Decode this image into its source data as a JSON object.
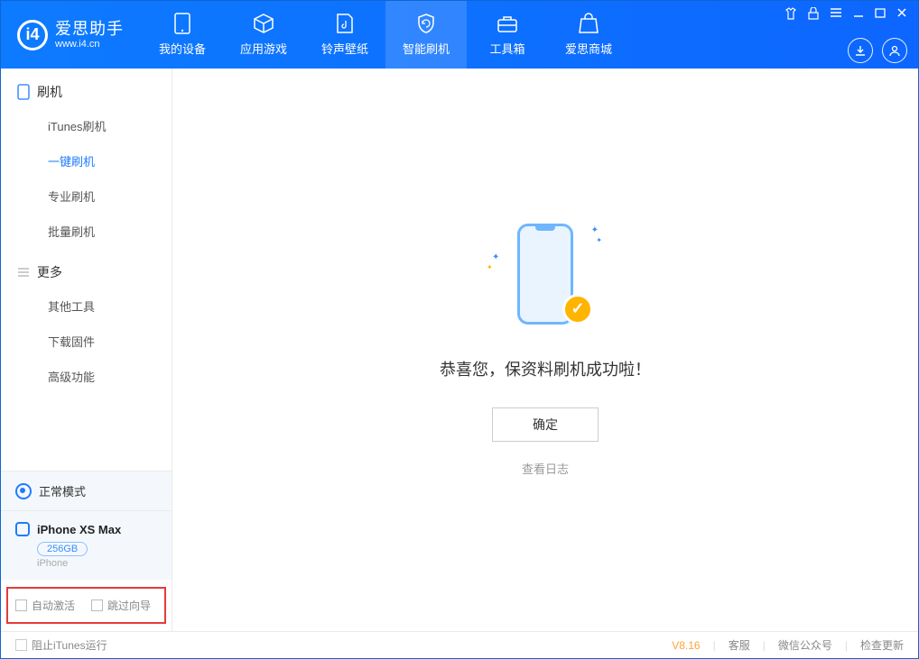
{
  "app": {
    "name_cn": "爱思助手",
    "name_en": "www.i4.cn"
  },
  "nav": [
    {
      "label": "我的设备"
    },
    {
      "label": "应用游戏"
    },
    {
      "label": "铃声壁纸"
    },
    {
      "label": "智能刷机"
    },
    {
      "label": "工具箱"
    },
    {
      "label": "爱思商城"
    }
  ],
  "sidebar": {
    "section1_title": "刷机",
    "items1": [
      {
        "label": "iTunes刷机"
      },
      {
        "label": "一键刷机"
      },
      {
        "label": "专业刷机"
      },
      {
        "label": "批量刷机"
      }
    ],
    "section2_title": "更多",
    "items2": [
      {
        "label": "其他工具"
      },
      {
        "label": "下载固件"
      },
      {
        "label": "高级功能"
      }
    ],
    "mode_text": "正常模式",
    "device": {
      "name": "iPhone XS Max",
      "capacity": "256GB",
      "type": "iPhone"
    },
    "checkbox1": "自动激活",
    "checkbox2": "跳过向导"
  },
  "main": {
    "success_text": "恭喜您，保资料刷机成功啦！",
    "ok_button": "确定",
    "view_log": "查看日志"
  },
  "footer": {
    "block_itunes": "阻止iTunes运行",
    "version": "V8.16",
    "link1": "客服",
    "link2": "微信公众号",
    "link3": "检查更新"
  }
}
